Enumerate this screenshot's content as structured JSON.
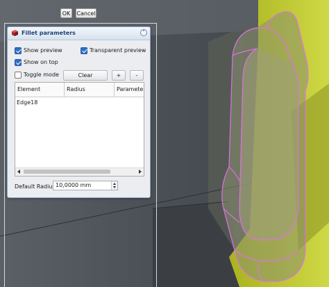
{
  "top_buttons": {
    "ok": "OK",
    "cancel": "Cancel"
  },
  "dialog": {
    "title": "Fillet parameters",
    "icon": "fillet-box-icon",
    "collapse_icon": "chevron-up-icon",
    "show_preview": {
      "label": "Show preview",
      "checked": true
    },
    "transparent_preview": {
      "label": "Transparent preview",
      "checked": true
    },
    "show_on_top": {
      "label": "Show on top",
      "checked": true
    },
    "toggle_mode": {
      "label": "Toggle mode",
      "checked": false
    },
    "clear_label": "Clear",
    "add_label": "+",
    "remove_label": "-",
    "table": {
      "columns": [
        "Element",
        "Radius",
        "Parameter"
      ],
      "rows": [
        {
          "element": "Edge18"
        }
      ]
    },
    "default_radius": {
      "label": "Default Radius:",
      "value": "10,0000 mm"
    }
  },
  "colors": {
    "accent": "#2f6fc4",
    "title_text": "#1f3f78",
    "fillet_preview": "#e070e8",
    "part_yellow": "#c5cf3a",
    "viewport_bg": "#4b5055"
  }
}
